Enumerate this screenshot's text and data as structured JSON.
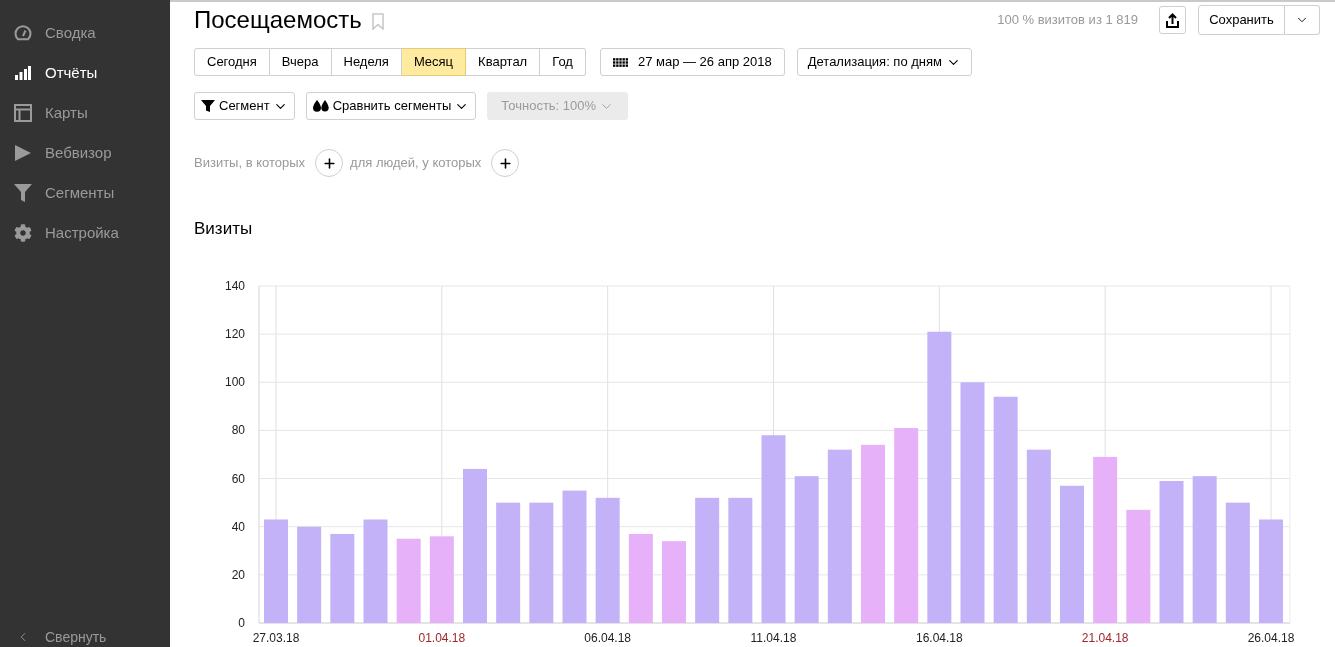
{
  "sidebar": {
    "items": [
      {
        "label": "Сводка",
        "selected": false
      },
      {
        "label": "Отчёты",
        "selected": true
      },
      {
        "label": "Карты",
        "selected": false
      },
      {
        "label": "Вебвизор",
        "selected": false
      },
      {
        "label": "Сегменты",
        "selected": false
      },
      {
        "label": "Настройка",
        "selected": false
      }
    ],
    "collapse_label": "Свернуть"
  },
  "header": {
    "title": "Посещаемость",
    "summary": "100 % визитов из 1 819",
    "save_button": "Сохранить"
  },
  "periods": [
    {
      "label": "Сегодня",
      "selected": false
    },
    {
      "label": "Вчера",
      "selected": false
    },
    {
      "label": "Неделя",
      "selected": false
    },
    {
      "label": "Месяц",
      "selected": true
    },
    {
      "label": "Квартал",
      "selected": false
    },
    {
      "label": "Год",
      "selected": false
    }
  ],
  "date_range": "27 мар — 26 апр 2018",
  "detail": "Детализация: по дням",
  "filters": [
    {
      "label": "Сегмент",
      "disabled": false
    },
    {
      "label": "Сравнить сегменты",
      "disabled": false
    },
    {
      "label": "Точность: 100%",
      "disabled": true
    }
  ],
  "conditions": [
    "Визиты, в которых",
    "для людей, у которых"
  ],
  "chart_section": {
    "chart_data": {
      "type": "bar",
      "title": "Визиты",
      "stacked": true,
      "grid": true,
      "categories": [
        "27.03.18",
        null,
        null,
        null,
        null,
        "01.04.18",
        null,
        null,
        null,
        null,
        "06.04.18",
        null,
        null,
        null,
        null,
        "11.04.18",
        null,
        null,
        null,
        null,
        "16.04.18",
        null,
        null,
        null,
        null,
        "21.04.18",
        null,
        null,
        null,
        null,
        "26.04.18"
      ],
      "series": [
        {
          "color": "#c3b2f7",
          "values": [
            43,
            40,
            37,
            43,
            null,
            null,
            64,
            50,
            50,
            55,
            52,
            null,
            null,
            52,
            52,
            78,
            61,
            72,
            null,
            null,
            121,
            100,
            94,
            72,
            57,
            null,
            null,
            59,
            61,
            50,
            43
          ]
        },
        {
          "color": "#e6b1f8",
          "values": [
            null,
            null,
            null,
            null,
            35,
            36,
            null,
            null,
            null,
            null,
            null,
            37,
            34,
            null,
            null,
            null,
            null,
            null,
            74,
            81,
            null,
            null,
            null,
            null,
            null,
            69,
            47,
            null,
            null,
            null,
            null
          ]
        }
      ],
      "ylim": [
        0,
        140
      ],
      "yticks": [
        0,
        20,
        40,
        60,
        80,
        100,
        120,
        140
      ]
    }
  }
}
